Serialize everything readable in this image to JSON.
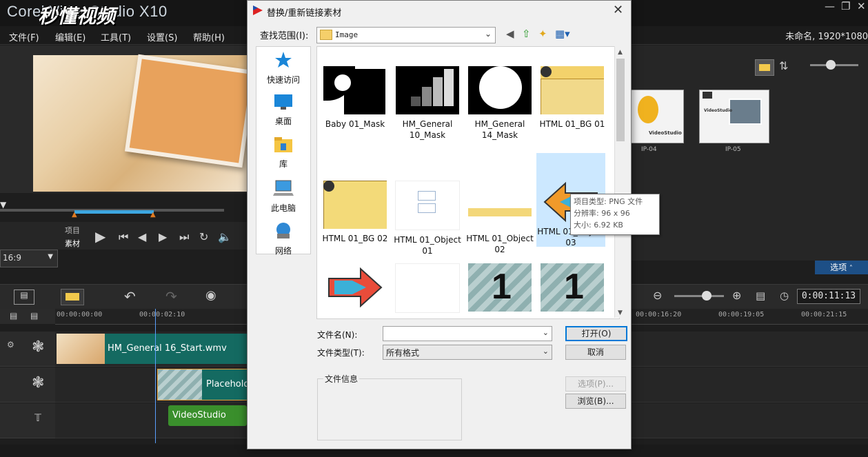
{
  "app": {
    "title": "Corel VideoStudio X10",
    "watermark": "秒懂视频",
    "menu": [
      "文件(F)",
      "编辑(E)",
      "工具(T)",
      "设置(S)",
      "帮助(H)"
    ],
    "project_info": "未命名, 1920*1080",
    "preview": {
      "item_label": "项目",
      "clip_label": "素材",
      "aspect": "16:9"
    },
    "library": {
      "thumbs": [
        "IP-04",
        "IP-05"
      ],
      "options_tab": "选项"
    },
    "timeline": {
      "timecode": "0:00:11:13",
      "ruler": [
        "00:00:00:00",
        "00:00:02:10",
        "00:00:16:20",
        "00:00:19:05",
        "00:00:21:15"
      ],
      "clips": {
        "video": "HM_General 16_Start.wmv",
        "overlay": "Placeholder",
        "title": "VideoStudio"
      }
    }
  },
  "dialog": {
    "title": "替换/重新链接素材",
    "lookin_label": "查找范围(I):",
    "lookin_value": "Image",
    "places": [
      {
        "label": "快速访问",
        "icon": "star-icon"
      },
      {
        "label": "桌面",
        "icon": "desktop-icon"
      },
      {
        "label": "库",
        "icon": "library-icon"
      },
      {
        "label": "此电脑",
        "icon": "computer-icon"
      },
      {
        "label": "网络",
        "icon": "network-icon"
      }
    ],
    "files": [
      {
        "label": "Baby 01_Mask"
      },
      {
        "label": "HM_General 10_Mask"
      },
      {
        "label": "HM_General 14_Mask"
      },
      {
        "label": "HTML 01_BG 01"
      },
      {
        "label": "HTML 01_BG 02"
      },
      {
        "label": "HTML 01_Object 01"
      },
      {
        "label": "HTML 01_Object 02"
      },
      {
        "label": "HTML 01_Object 03"
      },
      {
        "label": ""
      },
      {
        "label": ""
      },
      {
        "label": ""
      },
      {
        "label": ""
      }
    ],
    "tooltip": {
      "type": "项目类型: PNG 文件",
      "resolution": "分辨率: 96 x 96",
      "size": "大小: 6.92 KB"
    },
    "filename_label": "文件名(N):",
    "filename_value": "",
    "filetype_label": "文件类型(T):",
    "filetype_value": "所有格式",
    "open_button": "打开(O)",
    "cancel_button": "取消",
    "options_button": "选项(P)...",
    "browse_button": "浏览(B)...",
    "fileinfo_label": "文件信息"
  }
}
